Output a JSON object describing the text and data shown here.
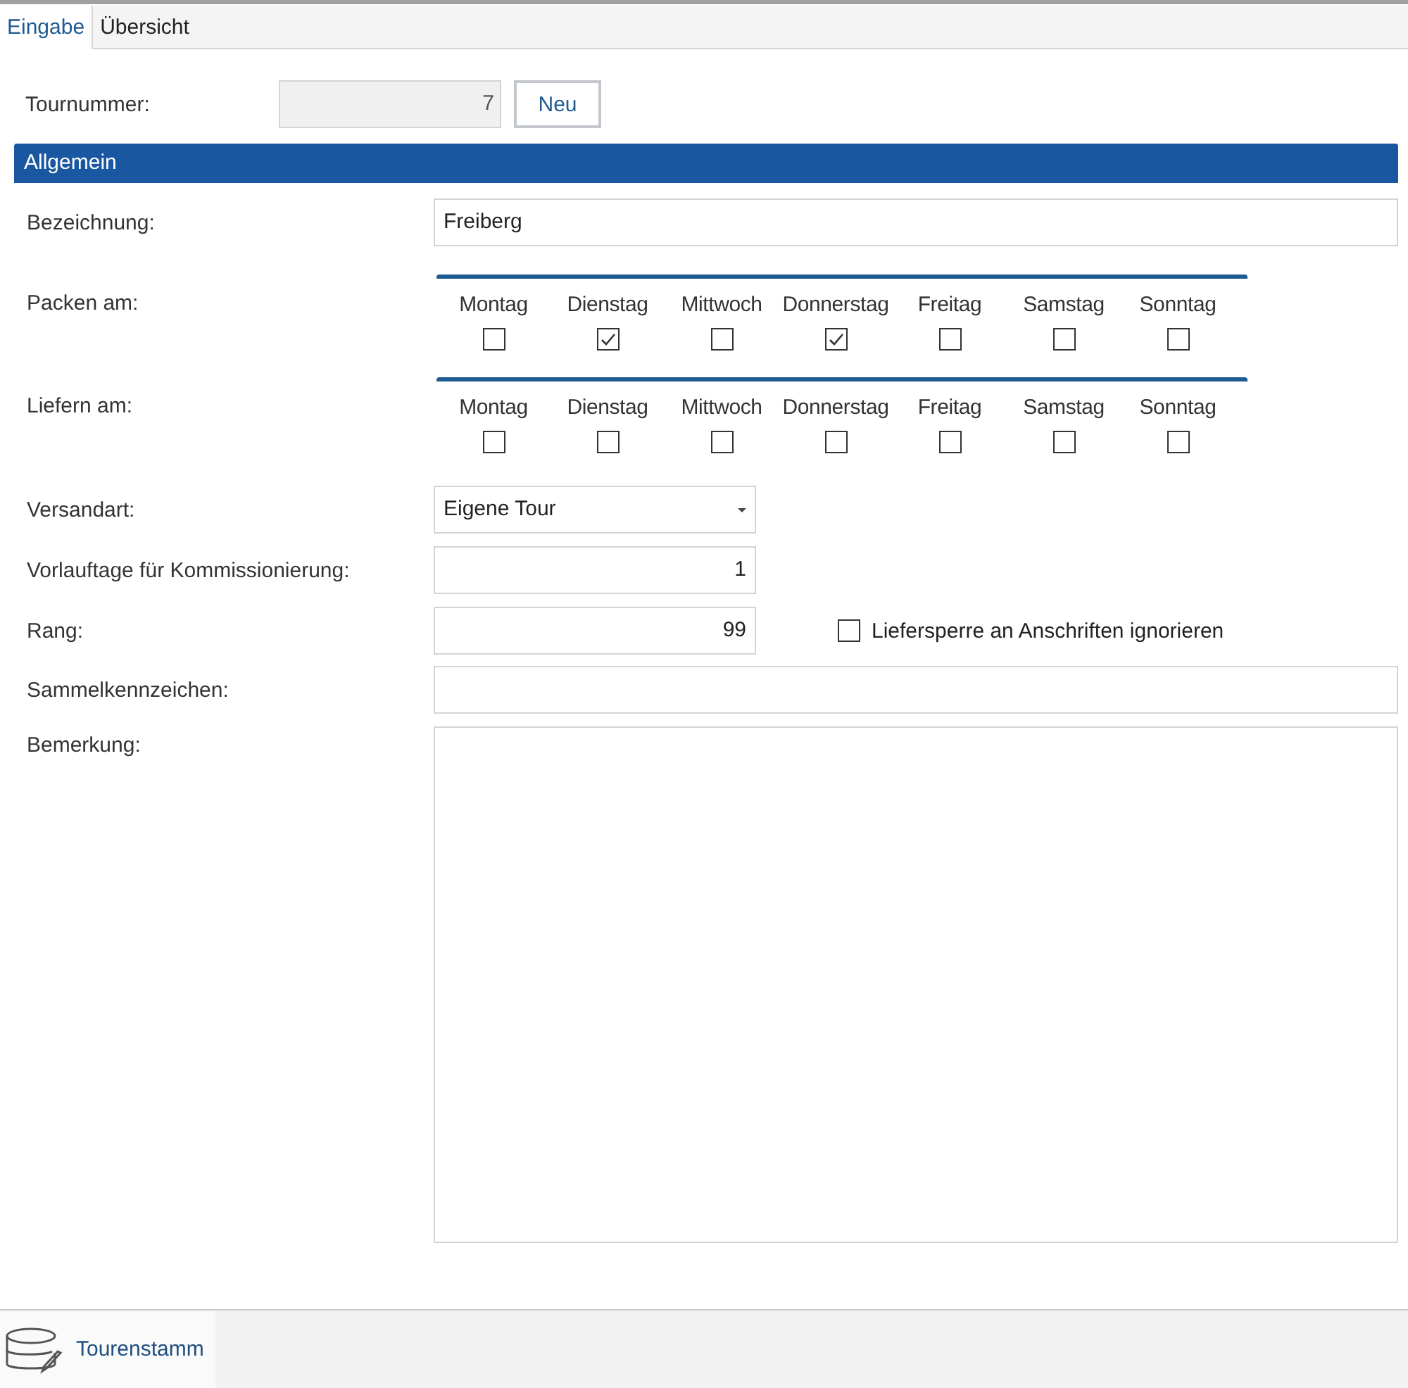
{
  "tabs": [
    {
      "label": "Eingabe",
      "selected": true
    },
    {
      "label": "Übersicht",
      "selected": false
    }
  ],
  "tour_number": {
    "label": "Tournummer:",
    "value": "7",
    "button": "Neu"
  },
  "section": {
    "title": "Allgemein"
  },
  "designation": {
    "label": "Bezeichnung:",
    "value": "Freiberg"
  },
  "pack_days": {
    "label": "Packen am:",
    "days": [
      {
        "label": "Montag",
        "checked": false
      },
      {
        "label": "Dienstag",
        "checked": true
      },
      {
        "label": "Mittwoch",
        "checked": false
      },
      {
        "label": "Donnerstag",
        "checked": true
      },
      {
        "label": "Freitag",
        "checked": false
      },
      {
        "label": "Samstag",
        "checked": false
      },
      {
        "label": "Sonntag",
        "checked": false
      }
    ]
  },
  "delivery_days": {
    "label": "Liefern am:",
    "days": [
      {
        "label": "Montag",
        "checked": false
      },
      {
        "label": "Dienstag",
        "checked": false
      },
      {
        "label": "Mittwoch",
        "checked": false
      },
      {
        "label": "Donnerstag",
        "checked": false
      },
      {
        "label": "Freitag",
        "checked": false
      },
      {
        "label": "Samstag",
        "checked": false
      },
      {
        "label": "Sonntag",
        "checked": false
      }
    ]
  },
  "shipping": {
    "label": "Versandart:",
    "value": "Eigene Tour"
  },
  "lead_days": {
    "label": "Vorlauftage für Kommissionierung:",
    "value": "1"
  },
  "rank": {
    "label": "Rang:",
    "value": "99",
    "option": {
      "label": "Liefersperre an Anschriften ignorieren",
      "checked": false
    }
  },
  "collective_code": {
    "label": "Sammelkennzeichen:"
  },
  "remark": {
    "label": "Bemerkung:"
  },
  "footer": {
    "items": [
      {
        "label": "Tourenstamm"
      }
    ]
  }
}
